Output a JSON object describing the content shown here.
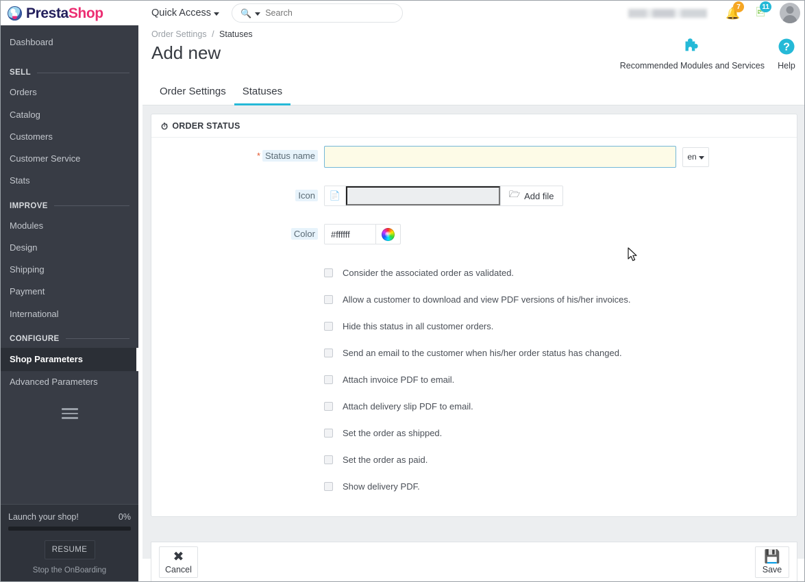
{
  "header": {
    "logo": {
      "part1": "Presta",
      "part2": "Shop",
      "icon": "prestashop-logo-icon"
    },
    "quick_access": "Quick Access",
    "search": {
      "placeholder": "Search",
      "icon": "search-icon"
    },
    "notifications": [
      {
        "icon": "bell-icon",
        "count": "7"
      },
      {
        "icon": "trade-image-icon",
        "count": "11"
      }
    ],
    "avatar": "user-avatar"
  },
  "sidebar": {
    "dashboard": "Dashboard",
    "sections": [
      {
        "title": "SELL",
        "items": [
          {
            "label": "Orders",
            "active": false
          },
          {
            "label": "Catalog",
            "active": false
          },
          {
            "label": "Customers",
            "active": false
          },
          {
            "label": "Customer Service",
            "active": false
          },
          {
            "label": "Stats",
            "active": false
          }
        ]
      },
      {
        "title": "IMPROVE",
        "items": [
          {
            "label": "Modules",
            "active": false
          },
          {
            "label": "Design",
            "active": false
          },
          {
            "label": "Shipping",
            "active": false
          },
          {
            "label": "Payment",
            "active": false
          },
          {
            "label": "International",
            "active": false
          }
        ]
      },
      {
        "title": "CONFIGURE",
        "items": [
          {
            "label": "Shop Parameters",
            "active": true
          },
          {
            "label": "Advanced Parameters",
            "active": false
          }
        ]
      }
    ],
    "onboarding": {
      "title": "Launch your shop!",
      "percent": "0%",
      "progress_value": 0,
      "resume_label": "RESUME",
      "stop_label": "Stop the OnBoarding"
    }
  },
  "page": {
    "breadcrumb": {
      "parent": "Order Settings",
      "separator": "/",
      "current": "Statuses"
    },
    "title": "Add new",
    "header_actions": [
      {
        "label": "Recommended Modules and Services",
        "icon": "puzzle-piece-icon"
      },
      {
        "label": "Help",
        "icon": "question-circle-icon"
      }
    ],
    "tabs": [
      {
        "label": "Order Settings",
        "active": false
      },
      {
        "label": "Statuses",
        "active": true
      }
    ]
  },
  "form": {
    "panel_title": "ORDER STATUS",
    "panel_icon": "clock-icon",
    "status_name": {
      "label": "Status name",
      "required_marker": "*",
      "value": "",
      "placeholder": "",
      "language": "en"
    },
    "icon_field": {
      "label": "Icon",
      "file_icon": "file-icon",
      "value": "",
      "add_file_label": "Add file",
      "add_file_icon": "folder-open-icon"
    },
    "color_field": {
      "label": "Color",
      "value": "#ffffff",
      "picker_icon": "color-wheel-icon"
    },
    "checkboxes": [
      {
        "label": "Consider the associated order as validated.",
        "checked": false
      },
      {
        "label": "Allow a customer to download and view PDF versions of his/her invoices.",
        "checked": false
      },
      {
        "label": "Hide this status in all customer orders.",
        "checked": false
      },
      {
        "label": "Send an email to the customer when his/her order status has changed.",
        "checked": false
      },
      {
        "label": "Attach invoice PDF to email.",
        "checked": false
      },
      {
        "label": "Attach delivery slip PDF to email.",
        "checked": false
      },
      {
        "label": "Set the order as shipped.",
        "checked": false
      },
      {
        "label": "Set the order as paid.",
        "checked": false
      },
      {
        "label": "Show delivery PDF.",
        "checked": false
      }
    ],
    "footer": {
      "cancel": {
        "label": "Cancel",
        "icon": "close-x-icon"
      },
      "save": {
        "label": "Save",
        "icon": "floppy-save-icon"
      }
    }
  },
  "colors": {
    "accent": "#25b9d7",
    "sidebar_bg": "#383c45",
    "brand_pink": "#ec2e72",
    "brand_navy": "#231f5c",
    "badge_orange": "#f5a623",
    "required_red": "#e4572e",
    "focus_border": "#73b7d8",
    "focus_bg": "#fdfbe7"
  }
}
